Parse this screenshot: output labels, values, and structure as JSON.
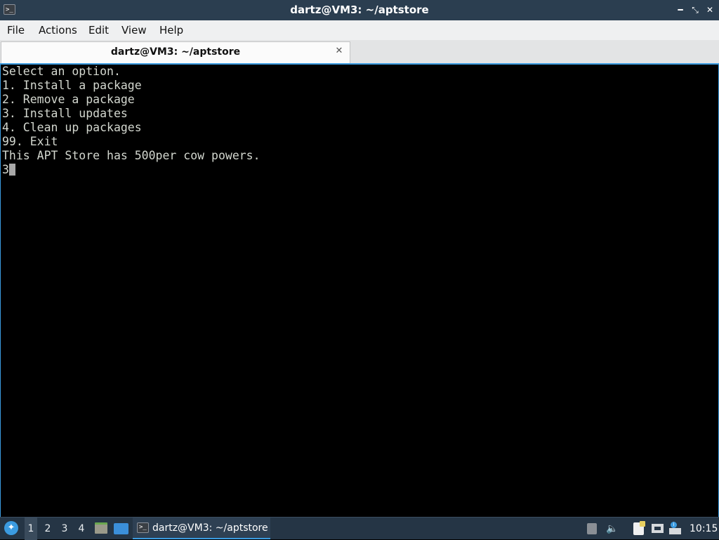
{
  "window": {
    "title": "dartz@VM3: ~/aptstore",
    "app_icon": "terminal-icon",
    "minimize_glyph": "━",
    "maximize_glyph": "⤡",
    "close_glyph": "✕"
  },
  "menubar": {
    "items": [
      "File",
      "Actions",
      "Edit",
      "View",
      "Help"
    ]
  },
  "tabs": [
    {
      "label": "dartz@VM3: ~/aptstore",
      "close_glyph": "✕"
    }
  ],
  "terminal": {
    "lines": [
      "Select an option.",
      "1. Install a package",
      "2. Remove a package",
      "3. Install updates",
      "4. Clean up packages",
      "99. Exit",
      "This APT Store has 500per cow powers.",
      "3"
    ]
  },
  "taskbar": {
    "start_icon": "lxqt-menu-icon",
    "desktops": [
      "1",
      "2",
      "3",
      "4"
    ],
    "active_desktop": "1",
    "quicklaunch": [
      "file-manager-icon",
      "show-desktop-icon"
    ],
    "task": {
      "label": "dartz@VM3: ~/aptstore",
      "icon": "terminal-icon"
    },
    "tray_icons": [
      "eject-icon",
      "volume-icon",
      "clipboard-icon",
      "network-icon",
      "update-notifier-icon"
    ],
    "clock": "10:15"
  }
}
